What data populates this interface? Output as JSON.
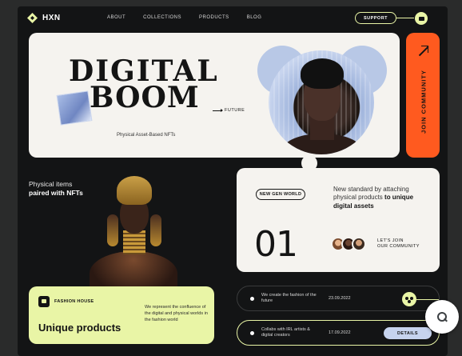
{
  "brand": {
    "name": "HXN"
  },
  "nav": {
    "links": [
      "ABOUT",
      "COLLECTIONS",
      "PRODUCTS",
      "BLOG"
    ],
    "support_label": "SUPPORT"
  },
  "hero": {
    "title_line1": "DIGITAL",
    "title_line2": "BOOM",
    "arrow_label": "FUTURE",
    "subtitle": "Physical Asset-Based NFTs"
  },
  "side_panel": {
    "label": "JOIN COMMUNITY"
  },
  "physical": {
    "line1": "Physical items",
    "line2": "paired with NFTs"
  },
  "new_gen": {
    "pill": "NEW GEN WORLD",
    "text_plain": "New standard by attaching physical products ",
    "text_bold": "to unique digital assets",
    "number": "01",
    "join_line1": "LET'S JOIN",
    "join_line2": "OUR COMMUNITY"
  },
  "fashion_house": {
    "label": "FASHION HOUSE",
    "title": "Unique products",
    "description": "We represent the confluence of the digital and physical worlds in the fashion world"
  },
  "timeline": [
    {
      "text": "We create the fashion of the future",
      "date": "23.09.2022"
    },
    {
      "text": "Collabs with IRL artists & digital creators",
      "date": "17.09.2022",
      "button": "DETAILS"
    }
  ],
  "colors": {
    "lime": "#e9f5a6",
    "orange": "#ff5a1f",
    "dark": "#131415",
    "card": "#f5f3ef"
  }
}
